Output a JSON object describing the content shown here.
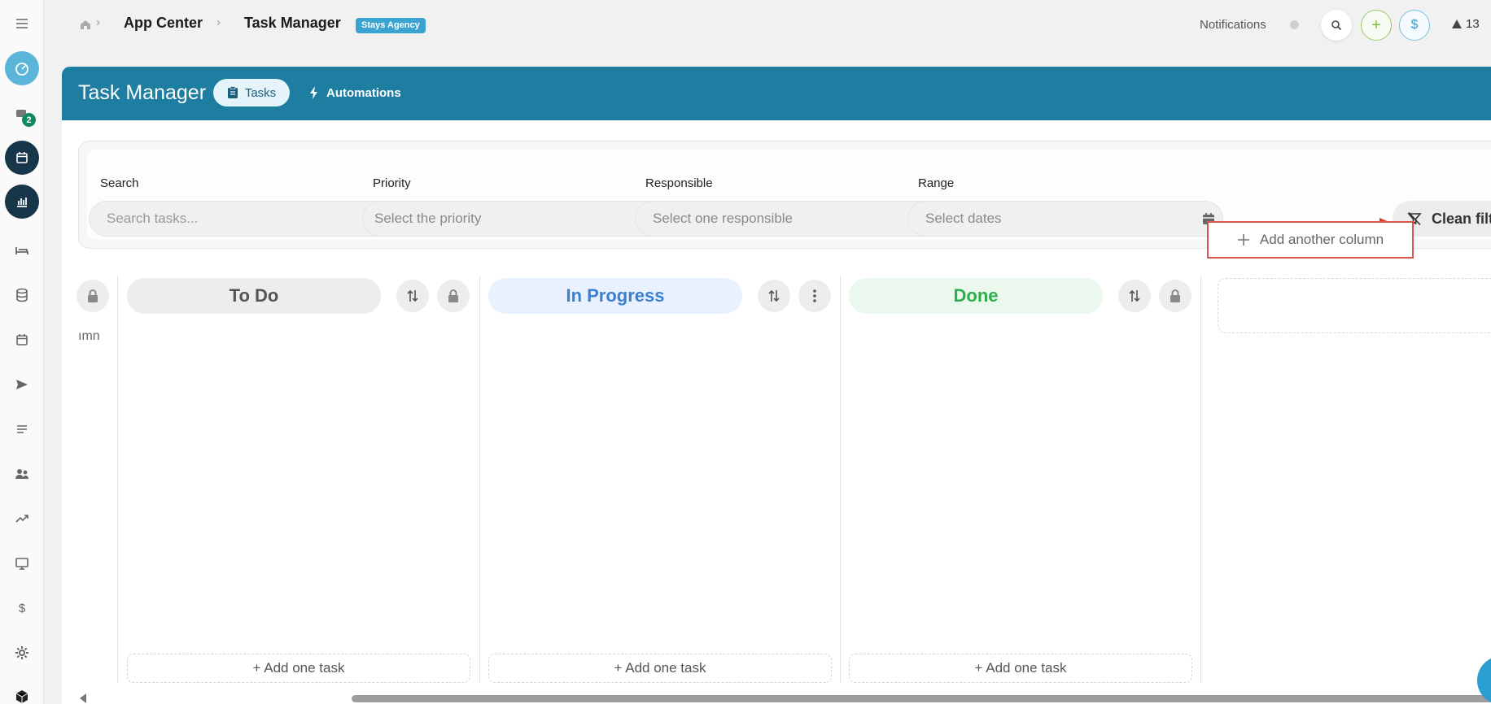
{
  "sidebar": {
    "messages_badge": "2",
    "icons": [
      "menu-icon",
      "dashboard-icon",
      "messages-icon",
      "calendar-icon",
      "analytics-icon",
      "bed-icon",
      "database-icon",
      "calendar-check-icon",
      "send-icon",
      "list-icon",
      "users-icon",
      "trending-icon",
      "monitor-icon",
      "dollar-icon",
      "gear-icon",
      "box-icon"
    ]
  },
  "topbar": {
    "breadcrumb_1": "App Center",
    "breadcrumb_2": "Task Manager",
    "agency_badge": "Stays Agency",
    "notifications_label": "Notifications",
    "plus_label": "+",
    "dollar_label": "$",
    "alert_count": "13"
  },
  "header": {
    "title": "Task Manager",
    "tab_tasks": "Tasks",
    "tab_automations": "Automations",
    "color": "#1d7ea2"
  },
  "filters": {
    "search_label": "Search",
    "search_placeholder": "Search tasks...",
    "priority_label": "Priority",
    "priority_placeholder": "Select the priority",
    "responsible_label": "Responsible",
    "responsible_placeholder": "Select one responsible",
    "range_label": "Range",
    "range_placeholder": "Select dates",
    "clean_label": "Clean filters"
  },
  "board": {
    "partial_column_text": "ımn",
    "columns": [
      {
        "title": "To Do",
        "color": "#555555",
        "bg": "#ededed",
        "add_task": "+ Add one task"
      },
      {
        "title": "In Progress",
        "color": "#3a7fd0",
        "bg": "#e8f1fd",
        "add_task": "+ Add one task"
      },
      {
        "title": "Done",
        "color": "#2fae4e",
        "bg": "#eaf8ee",
        "add_task": "+ Add one task"
      }
    ],
    "add_column_label": "Add another column"
  }
}
